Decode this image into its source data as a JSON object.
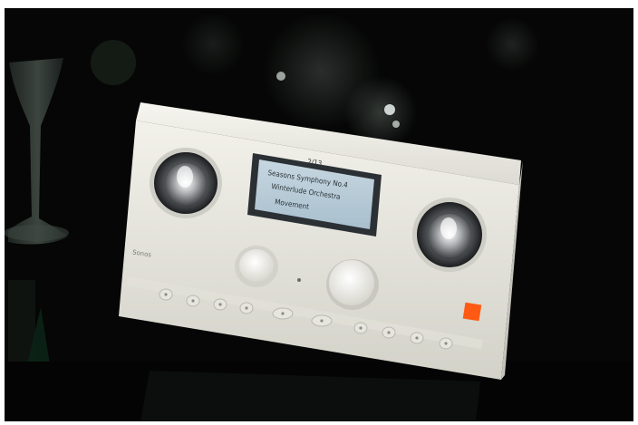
{
  "photo": {
    "subject": "",
    "device": {
      "brand_label": "Sonos",
      "display_lines": [
        "2/13",
        "Seasons Symphony No.4",
        "Winterlude Orchestra",
        "Movement"
      ],
      "accent_color": "#ff5a14",
      "body_color": "#e8e7e0"
    },
    "background_color": "#050605"
  }
}
